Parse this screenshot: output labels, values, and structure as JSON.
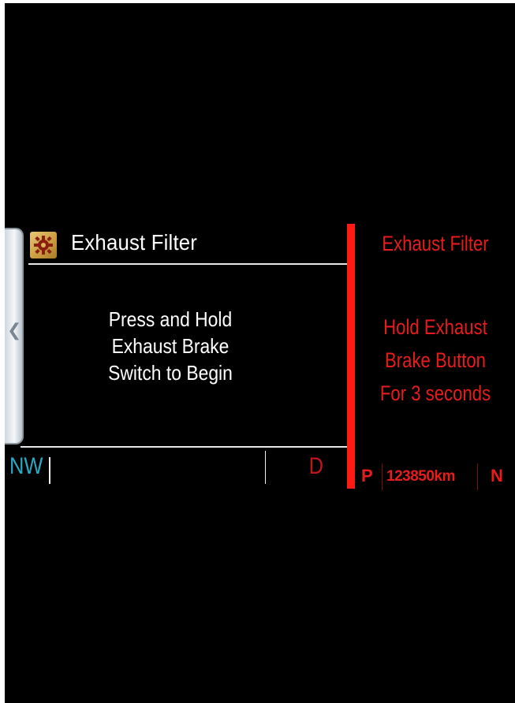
{
  "main_panel": {
    "title": "Exhaust Filter",
    "message_lines": [
      "Press and Hold",
      "Exhaust Brake",
      "Switch to Begin"
    ]
  },
  "status_bar": {
    "compass": "NW",
    "gear": "D"
  },
  "secondary_panel": {
    "title": "Exhaust Filter",
    "message_lines": [
      "Hold Exhaust",
      "Brake Button",
      "For 3 seconds"
    ],
    "park_indicator": "P",
    "odometer": "123850km",
    "neutral_indicator": "N"
  },
  "icons": {
    "header_icon": "gear-warning-icon",
    "side_tab_icon": "chevron-left-icon"
  },
  "colors": {
    "background": "#000000",
    "primary_text": "#ffffff",
    "compass_color": "#2aa9c4",
    "warning_red": "#e81c1c",
    "divider_red": "#ff1a14"
  }
}
